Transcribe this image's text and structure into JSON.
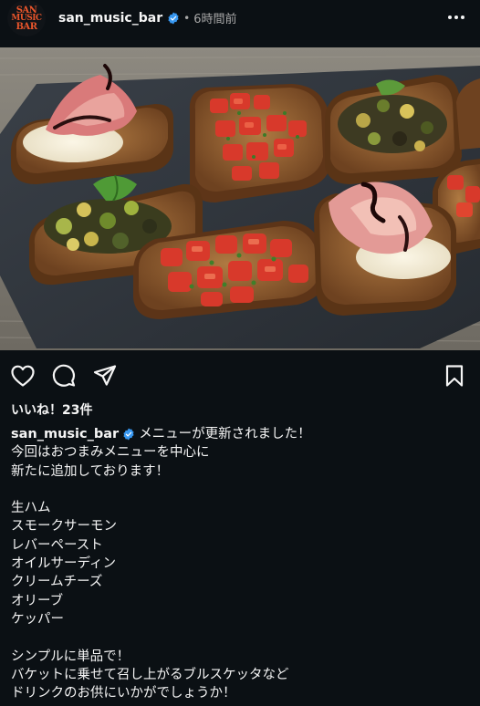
{
  "header": {
    "avatar": {
      "line1": "SAN",
      "line2": "MUSIC",
      "line3": "BAR"
    },
    "username": "san_music_bar",
    "verified_badge_icon": "verified-badge-icon",
    "separator": "•",
    "timestamp": "6時間前",
    "more_icon": "more-horizontal-icon"
  },
  "post": {
    "image_icon": "bruschetta-photo",
    "colors": {
      "background": "#0b1014",
      "slate": "#2b3138",
      "bread": "#8c5a2b",
      "tomato": "#d8392b",
      "verified": "#3797f0"
    }
  },
  "actions": {
    "like_icon": "heart-icon",
    "comment_icon": "comment-icon",
    "share_icon": "send-icon",
    "save_icon": "bookmark-icon"
  },
  "likes": {
    "text": "いいね！23件"
  },
  "caption": {
    "username": "san_music_bar",
    "first_line": "メニューが更新されました！",
    "lines": [
      "今回はおつまみメニューを中心に",
      "新たに追加しております！",
      "",
      "生ハム",
      "スモークサーモン",
      "レバーペースト",
      "オイルサーディン",
      "クリームチーズ",
      "オリーブ",
      "ケッパー",
      "",
      "シンプルに単品で！",
      "バケットに乗せて召し上がるブルスケッタなど",
      "ドリンクのお供にいかがでしょうか！"
    ]
  }
}
